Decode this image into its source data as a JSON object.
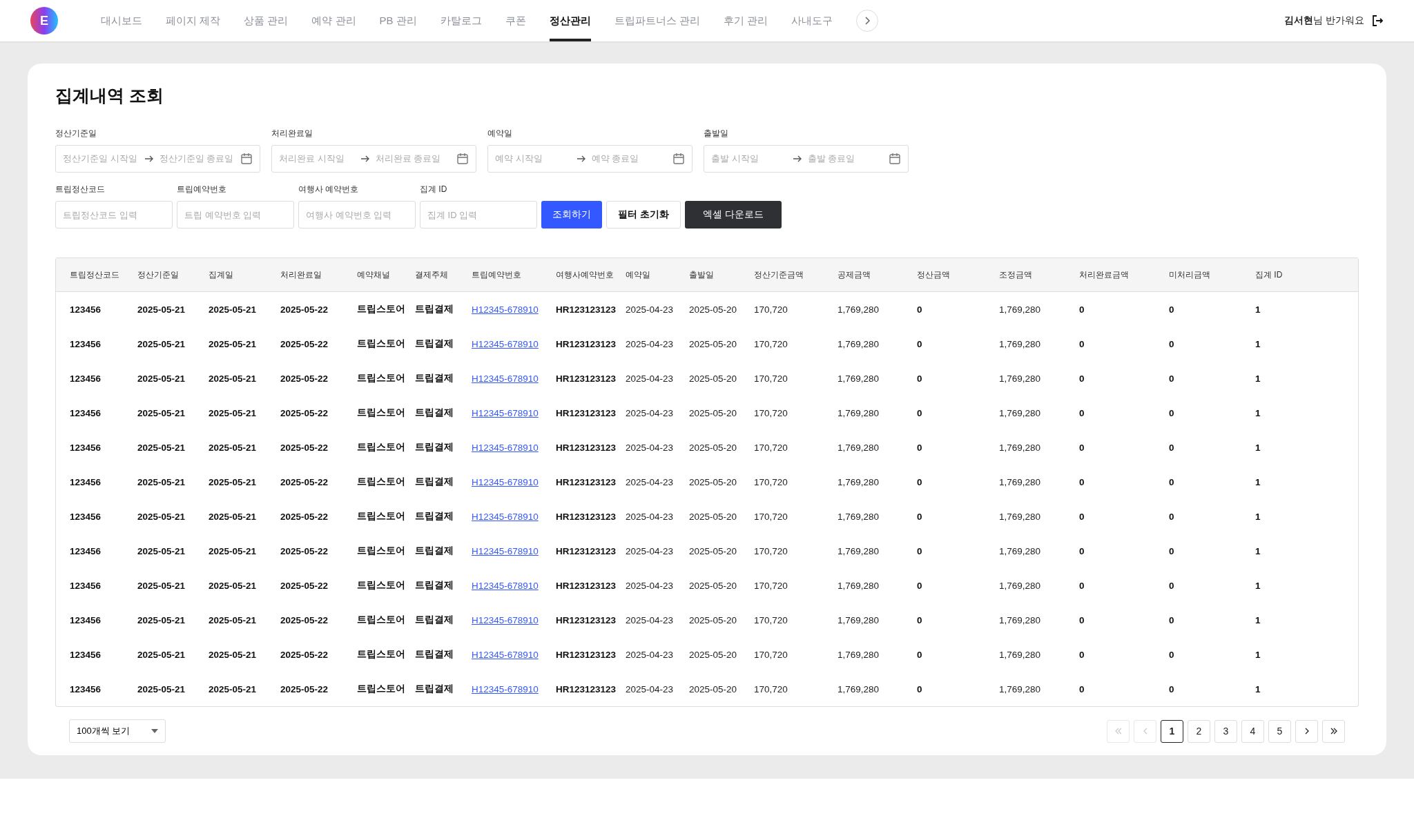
{
  "logo": {
    "text": "E"
  },
  "nav": [
    {
      "label": "대시보드",
      "selected": false
    },
    {
      "label": "페이지 제작",
      "selected": false
    },
    {
      "label": "상품 관리",
      "selected": false
    },
    {
      "label": "예약 관리",
      "selected": false
    },
    {
      "label": "PB 관리",
      "selected": false
    },
    {
      "label": "카탈로그",
      "selected": false
    },
    {
      "label": "쿠폰",
      "selected": false
    },
    {
      "label": "정산관리",
      "selected": true
    },
    {
      "label": "트립파트너스 관리",
      "selected": false
    },
    {
      "label": "후기 관리",
      "selected": false
    },
    {
      "label": "사내도구",
      "selected": false
    }
  ],
  "user": {
    "greeting": "**김서현**님 반가워요"
  },
  "title": "집계내역 조회",
  "date_filters": [
    {
      "label": "정산기준일",
      "start_placeholder": "정산기준일 시작일",
      "end_placeholder": "정산기준일 종료일"
    },
    {
      "label": "처리완료일",
      "start_placeholder": "처리완료 시작일",
      "end_placeholder": "처리완료 종료일"
    },
    {
      "label": "예약일",
      "start_placeholder": "예약 시작일",
      "end_placeholder": "예약 종료일"
    },
    {
      "label": "출발일",
      "start_placeholder": "출발 시작일",
      "end_placeholder": "출발 종료일"
    }
  ],
  "text_filters": [
    {
      "label": "트립정산코드",
      "placeholder": "트립정산코드 입력"
    },
    {
      "label": "트립예약번호",
      "placeholder": "트립 예약번호 입력"
    },
    {
      "label": "여행사 예약번호",
      "placeholder": "여행사 예약번호 입력"
    },
    {
      "label": "집계 ID",
      "placeholder": "집계 ID 입력"
    }
  ],
  "buttons": [
    {
      "label": "조회하기",
      "kind": "primary"
    },
    {
      "label": "필터 초기화",
      "kind": "outline"
    },
    {
      "label": "엑셀 다운로드",
      "kind": "dark"
    }
  ],
  "table": {
    "columns": [
      {
        "label": "트립정산코드",
        "kind": "strong"
      },
      {
        "label": "정산기준일",
        "kind": "strong"
      },
      {
        "label": "집계일",
        "kind": "strong"
      },
      {
        "label": "처리완료일",
        "kind": "strong"
      },
      {
        "label": "예약채널",
        "kind": "strong"
      },
      {
        "label": "결제주체",
        "kind": "strong"
      },
      {
        "label": "트립예약번호",
        "kind": "link"
      },
      {
        "label": "여행사예약번호",
        "kind": "strong"
      },
      {
        "label": "예약일",
        "kind": "plain"
      },
      {
        "label": "출발일",
        "kind": "plain"
      },
      {
        "label": "정산기준금액",
        "kind": "plain"
      },
      {
        "label": "공제금액",
        "kind": "plain"
      },
      {
        "label": "정산금액",
        "kind": "strong"
      },
      {
        "label": "조정금액",
        "kind": "plain"
      },
      {
        "label": "처리완료금액",
        "kind": "strong"
      },
      {
        "label": "미처리금액",
        "kind": "strong"
      },
      {
        "label": "집계 ID",
        "kind": "strong"
      }
    ],
    "rows": [
      [
        "123456",
        "2025-05-21",
        "2025-05-21",
        "2025-05-22",
        "트립스토어",
        "트립결제",
        "H12345-678910",
        "HR123123123",
        "2025-04-23",
        "2025-05-20",
        "170,720",
        "1,769,280",
        "0",
        "1,769,280",
        "0",
        "0",
        "1"
      ],
      [
        "123456",
        "2025-05-21",
        "2025-05-21",
        "2025-05-22",
        "트립스토어",
        "트립결제",
        "H12345-678910",
        "HR123123123",
        "2025-04-23",
        "2025-05-20",
        "170,720",
        "1,769,280",
        "0",
        "1,769,280",
        "0",
        "0",
        "1"
      ],
      [
        "123456",
        "2025-05-21",
        "2025-05-21",
        "2025-05-22",
        "트립스토어",
        "트립결제",
        "H12345-678910",
        "HR123123123",
        "2025-04-23",
        "2025-05-20",
        "170,720",
        "1,769,280",
        "0",
        "1,769,280",
        "0",
        "0",
        "1"
      ],
      [
        "123456",
        "2025-05-21",
        "2025-05-21",
        "2025-05-22",
        "트립스토어",
        "트립결제",
        "H12345-678910",
        "HR123123123",
        "2025-04-23",
        "2025-05-20",
        "170,720",
        "1,769,280",
        "0",
        "1,769,280",
        "0",
        "0",
        "1"
      ],
      [
        "123456",
        "2025-05-21",
        "2025-05-21",
        "2025-05-22",
        "트립스토어",
        "트립결제",
        "H12345-678910",
        "HR123123123",
        "2025-04-23",
        "2025-05-20",
        "170,720",
        "1,769,280",
        "0",
        "1,769,280",
        "0",
        "0",
        "1"
      ],
      [
        "123456",
        "2025-05-21",
        "2025-05-21",
        "2025-05-22",
        "트립스토어",
        "트립결제",
        "H12345-678910",
        "HR123123123",
        "2025-04-23",
        "2025-05-20",
        "170,720",
        "1,769,280",
        "0",
        "1,769,280",
        "0",
        "0",
        "1"
      ],
      [
        "123456",
        "2025-05-21",
        "2025-05-21",
        "2025-05-22",
        "트립스토어",
        "트립결제",
        "H12345-678910",
        "HR123123123",
        "2025-04-23",
        "2025-05-20",
        "170,720",
        "1,769,280",
        "0",
        "1,769,280",
        "0",
        "0",
        "1"
      ],
      [
        "123456",
        "2025-05-21",
        "2025-05-21",
        "2025-05-22",
        "트립스토어",
        "트립결제",
        "H12345-678910",
        "HR123123123",
        "2025-04-23",
        "2025-05-20",
        "170,720",
        "1,769,280",
        "0",
        "1,769,280",
        "0",
        "0",
        "1"
      ],
      [
        "123456",
        "2025-05-21",
        "2025-05-21",
        "2025-05-22",
        "트립스토어",
        "트립결제",
        "H12345-678910",
        "HR123123123",
        "2025-04-23",
        "2025-05-20",
        "170,720",
        "1,769,280",
        "0",
        "1,769,280",
        "0",
        "0",
        "1"
      ],
      [
        "123456",
        "2025-05-21",
        "2025-05-21",
        "2025-05-22",
        "트립스토어",
        "트립결제",
        "H12345-678910",
        "HR123123123",
        "2025-04-23",
        "2025-05-20",
        "170,720",
        "1,769,280",
        "0",
        "1,769,280",
        "0",
        "0",
        "1"
      ],
      [
        "123456",
        "2025-05-21",
        "2025-05-21",
        "2025-05-22",
        "트립스토어",
        "트립결제",
        "H12345-678910",
        "HR123123123",
        "2025-04-23",
        "2025-05-20",
        "170,720",
        "1,769,280",
        "0",
        "1,769,280",
        "0",
        "0",
        "1"
      ],
      [
        "123456",
        "2025-05-21",
        "2025-05-21",
        "2025-05-22",
        "트립스토어",
        "트립결제",
        "H12345-678910",
        "HR123123123",
        "2025-04-23",
        "2025-05-20",
        "170,720",
        "1,769,280",
        "0",
        "1,769,280",
        "0",
        "0",
        "1"
      ]
    ]
  },
  "page_size": {
    "value": "100개씩 보기"
  },
  "pagination": {
    "first_disabled": true,
    "prev_disabled": true,
    "pages": [
      {
        "label": "1",
        "selected": true
      },
      {
        "label": "2",
        "selected": false
      },
      {
        "label": "3",
        "selected": false
      },
      {
        "label": "4",
        "selected": false
      },
      {
        "label": "5",
        "selected": false
      }
    ],
    "next_disabled": false,
    "last_disabled": false
  }
}
